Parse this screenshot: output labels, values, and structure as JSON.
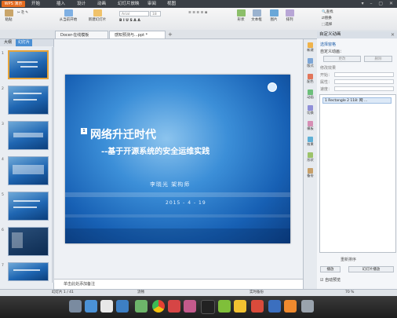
{
  "app": {
    "logo_label": "WPS 演示"
  },
  "menu": [
    "开始",
    "插入",
    "设计",
    "动画",
    "幻灯片放映",
    "审阅",
    "视图"
  ],
  "ribbon": {
    "paste": "粘贴",
    "from_current": "从当前开始",
    "new_slide": "新建幻灯片",
    "font_name": "Arial",
    "font_size": "18",
    "shape": "形状",
    "textbox": "文本框",
    "picture": "图片",
    "arrange": "排列",
    "find": "查找",
    "replace": "替换",
    "select": "选择"
  },
  "tabs": [
    {
      "label": "Docer-在线模板"
    },
    {
      "label": "感知预测与...ppt *"
    }
  ],
  "left_panel": {
    "tab_outline": "大纲",
    "tab_slides": "幻灯片",
    "slide_numbers": [
      "1",
      "2",
      "3",
      "4",
      "5",
      "6",
      "7"
    ]
  },
  "slide": {
    "number": "1",
    "title": "网络升迁时代",
    "subtitle": "--基于开源系统的安全运维实践",
    "author": "李晓光   架构师",
    "date": "2015 - 4 - 19"
  },
  "notes_placeholder": "单击此处添加备注",
  "right_toolbar": [
    "新建",
    "版式",
    "配色",
    "动画",
    "切换",
    "模板",
    "效果",
    "形状",
    "备份"
  ],
  "task_pane": {
    "title": "自定义动画",
    "section_select": "选择窗格",
    "section_custom": "自定义动画：",
    "change_button": "更改",
    "delete_button": "删除",
    "modify_label": "修改效果",
    "start_label": "开始：",
    "property_label": "属性：",
    "speed_label": "速度：",
    "anim_item": "1  Rectangle 2 118: 网 ...",
    "reorder_label": "重新排序",
    "play_button": "播放",
    "slideshow_button": "幻灯片播放",
    "autopreview": "自动预览"
  },
  "status": {
    "slide_info": "幻灯片 1 / 41",
    "theme": "流畅",
    "backup": "实时备份",
    "zoom": "70 %"
  },
  "dock_icons": [
    "finder-icon",
    "folder-icon",
    "calendar-icon",
    "browser-icon",
    "pictures-icon",
    "settings-icon",
    "terminal-icon",
    "music-icon",
    "game-icon",
    "store-icon",
    "help-icon",
    "wps-icon",
    "trash-icon"
  ],
  "colors": {
    "accent": "#e46b1f",
    "slide_blue": "#1760b4"
  }
}
